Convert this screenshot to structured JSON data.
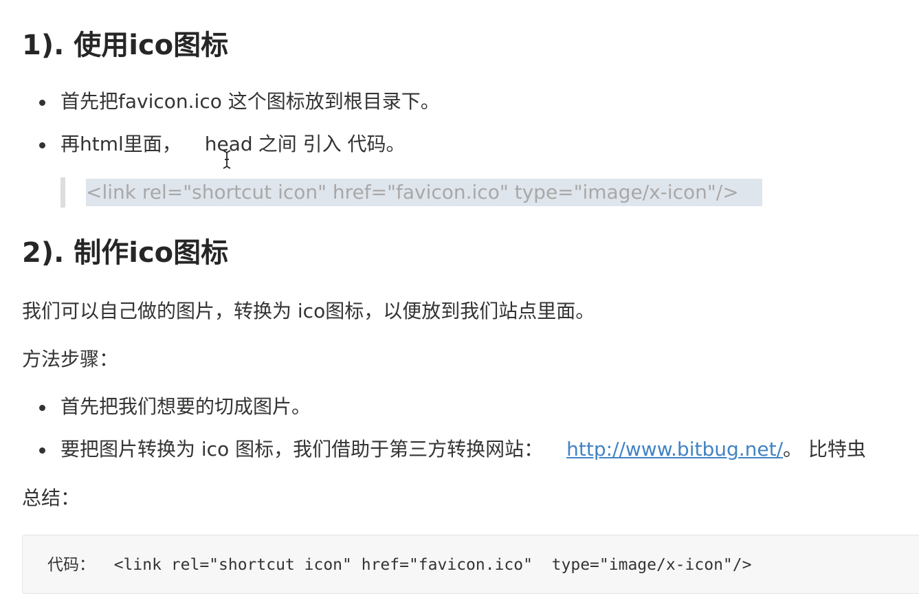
{
  "section1": {
    "heading": "1). 使用ico图标",
    "items": [
      "首先把favicon.ico 这个图标放到根目录下。",
      {
        "before": "再html里面，",
        "code": "head",
        "after": "之间 引入 代码。"
      }
    ],
    "quote": "<link rel=\"shortcut icon\" href=\"favicon.ico\"  type=\"image/x-icon\"/>"
  },
  "section2": {
    "heading": "2). 制作ico图标",
    "intro": "我们可以自己做的图片，转换为 ico图标，以便放到我们站点里面。",
    "steps_label": "方法步骤：",
    "items": [
      "首先把我们想要的切成图片。",
      {
        "text": "要把图片转换为 ico 图标，我们借助于第三方转换网站：",
        "link": "http://www.bitbug.net/",
        "after": "。 比特虫"
      }
    ],
    "summary_label": "总结：",
    "code_block": "代码：  <link rel=\"shortcut icon\" href=\"favicon.ico\"  type=\"image/x-icon\"/>"
  }
}
